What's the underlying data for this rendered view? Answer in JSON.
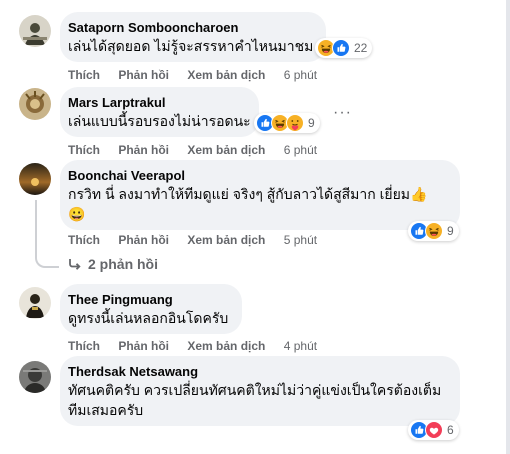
{
  "comments": [
    {
      "author": "Sataporn Sombooncharoen",
      "text": [
        "เล่นได้สุดยอด ไม่รู้จะสรรหาคำไหนมาชม"
      ],
      "actions": {
        "like": "Thích",
        "reply": "Phản hồi",
        "translate": "Xem bản dịch",
        "time": "6 phút"
      },
      "reactions": {
        "icons": [
          "haha-icon",
          "like-icon"
        ],
        "count": "22"
      }
    },
    {
      "author": "Mars Larptrakul",
      "text": [
        "เล่นแบบนี้รอบรองไม่น่ารอดนะ"
      ],
      "actions": {
        "like": "Thích",
        "reply": "Phản hồi",
        "translate": "Xem bản dịch",
        "time": "6 phút"
      },
      "reactions": {
        "icons": [
          "like-icon",
          "haha-icon",
          "care-icon"
        ],
        "count": "9"
      },
      "more": "···"
    },
    {
      "author": "Boonchai Veerapol",
      "text": [
        "กรวิท นี่ ลงมาทำให้ทีมดูแย่ จริงๆ สู้กับลาวได้สูสีมาก เยี่ยม👍",
        "😀"
      ],
      "actions": {
        "like": "Thích",
        "reply": "Phản hồi",
        "translate": "Xem bản dịch",
        "time": "5 phút"
      },
      "reactions": {
        "icons": [
          "like-icon",
          "haha-icon"
        ],
        "count": "9"
      },
      "replies": "2 phản hồi"
    },
    {
      "author": "Thee Pingmuang",
      "text": [
        "ดูทรงนี้เล่นหลอกอินโดครับ"
      ],
      "actions": {
        "like": "Thích",
        "reply": "Phản hồi",
        "translate": "Xem bản dịch",
        "time": "4 phút"
      }
    },
    {
      "author": "Therdsak Netsawang",
      "text": [
        "ทัศนคติครับ ควรเปลี่ยนทัศนคติใหม่ไม่ว่าคู่แข่งเป็นใครต้องเต็ม",
        "ทีมเสมอครับ"
      ],
      "actions": {
        "like": "Thích",
        "reply": "Phản hồi",
        "translate": "Xem bản dịch",
        "time": "5 phút"
      },
      "reactions": {
        "icons": [
          "like-icon",
          "love-icon"
        ],
        "count": "6"
      }
    }
  ],
  "colors": {
    "like": "#1877f2",
    "haha": "#f7b125",
    "love": "#f33e58",
    "bubble": "#f0f2f5",
    "secondary_text": "#65676b"
  }
}
